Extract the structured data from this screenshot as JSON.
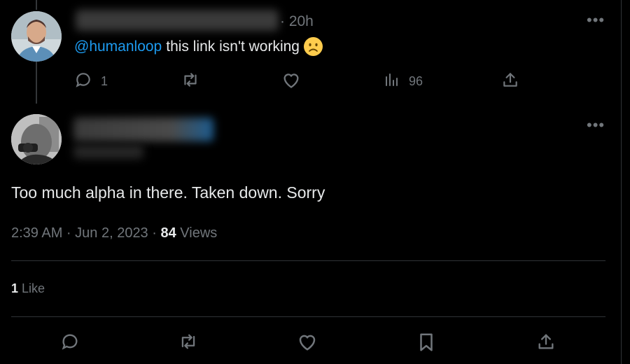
{
  "reply": {
    "time": "· 20h",
    "mention": "@humanloop",
    "text": "this link isn't working",
    "emoji_icon": "slightly-frowning-face-icon",
    "actions": {
      "reply_count": "1",
      "repost_count": "",
      "like_count": "",
      "views_count": "96"
    }
  },
  "main_tweet": {
    "text": "Too much alpha in there. Taken down. Sorry",
    "timestamp": "2:39 AM · Jun 2, 2023 · ",
    "views_count": "84",
    "views_label": " Views",
    "likes_count": "1",
    "likes_label": " Like"
  },
  "colors": {
    "background": "#000000",
    "text": "#e7e9ea",
    "muted": "#71767b",
    "link": "#1d9bf0",
    "divider": "#2f3336"
  }
}
